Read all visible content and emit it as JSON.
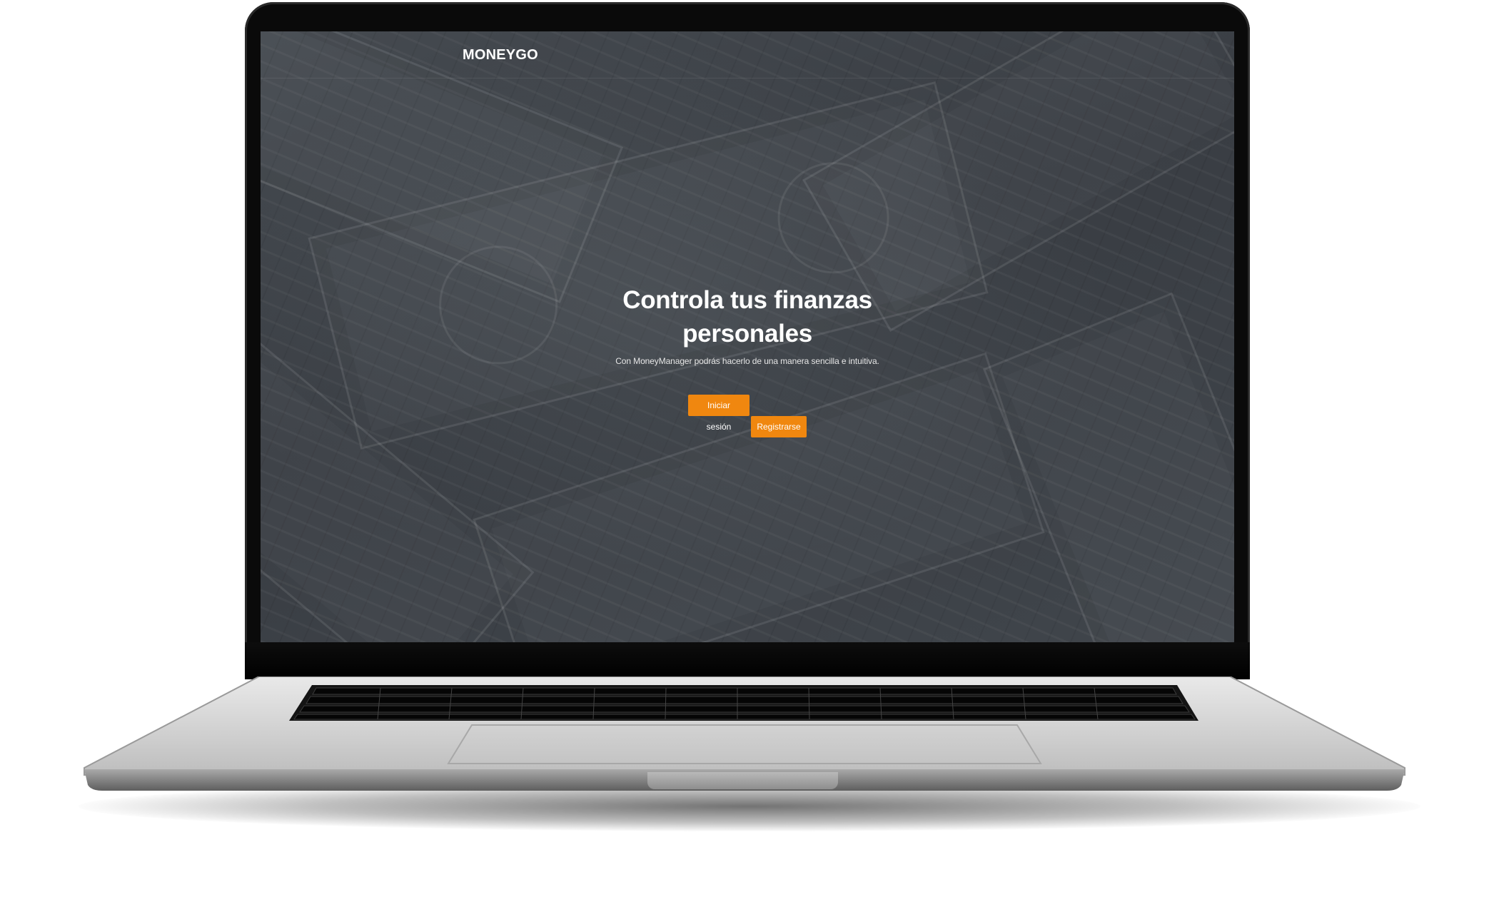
{
  "app": {
    "brand": "MONEYGO"
  },
  "hero": {
    "title": "Controla tus finanzas personales",
    "subtitle": "Con MoneyManager podrás hacerlo de una manera sencilla e intuitiva."
  },
  "actions": {
    "login_label": "Iniciar sesión",
    "register_label": "Registrarse"
  },
  "colors": {
    "accent": "#f0870f",
    "overlay": "#3b3f45"
  },
  "device": {
    "type": "laptop-mockup"
  }
}
